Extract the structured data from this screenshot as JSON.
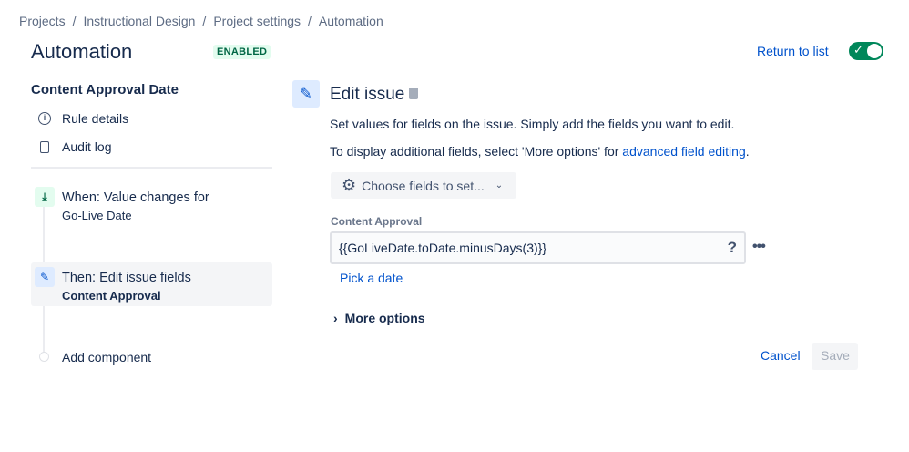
{
  "breadcrumbs": [
    "Projects",
    "Instructional Design",
    "Project settings",
    "Automation"
  ],
  "header": {
    "title": "Automation",
    "status_badge": "ENABLED",
    "return_link": "Return to list",
    "enabled": true
  },
  "sidebar": {
    "rule_name": "Content Approval Date",
    "menu": [
      {
        "label": "Rule details",
        "icon": "info-icon"
      },
      {
        "label": "Audit log",
        "icon": "document-icon"
      }
    ],
    "components": [
      {
        "title": "When: Value changes for",
        "subtitle": "Go-Live Date"
      },
      {
        "title": "Then: Edit issue fields",
        "subtitle": "Content Approval"
      }
    ],
    "add_component": "Add component"
  },
  "editor": {
    "title": "Edit issue",
    "desc1": "Set values for fields on the issue. Simply add the fields you want to edit.",
    "desc2_prefix": "To display additional fields, select 'More options' for ",
    "desc2_link": "advanced field editing",
    "desc2_suffix": ".",
    "choose_fields": "Choose fields to set...",
    "field_label": "Content Approval",
    "field_value": "{{GoLiveDate.toDate.minusDays(3)}}",
    "help": "?",
    "pick_date": "Pick a date",
    "more_options": "More options",
    "cancel": "Cancel",
    "save": "Save"
  }
}
